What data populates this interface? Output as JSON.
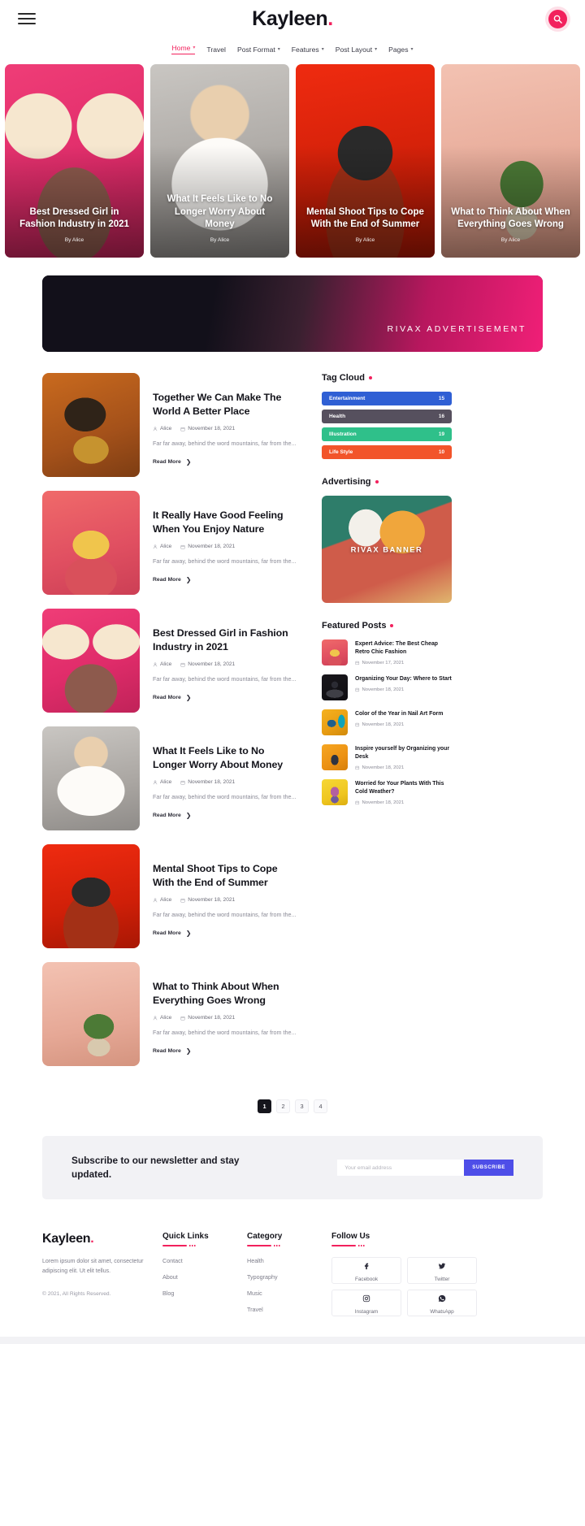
{
  "header": {
    "brand": "Kayleen",
    "brand_dot": ".",
    "menu_icon": "hamburger-icon",
    "search_icon": "search-icon",
    "accent_color": "#f2215d"
  },
  "nav": {
    "items": [
      {
        "label": "Home",
        "has_caret": true,
        "active": true
      },
      {
        "label": "Travel",
        "has_caret": false,
        "active": false
      },
      {
        "label": "Post Format",
        "has_caret": true,
        "active": false
      },
      {
        "label": "Features",
        "has_caret": true,
        "active": false
      },
      {
        "label": "Post Layout",
        "has_caret": true,
        "active": false
      },
      {
        "label": "Pages",
        "has_caret": true,
        "active": false
      }
    ]
  },
  "hero": {
    "slides": [
      {
        "title": "Best Dressed Girl in Fashion Industry in 2021",
        "by": "By Alice",
        "img": "ph1"
      },
      {
        "title": "What It Feels Like to No Longer Worry About Money",
        "by": "By Alice",
        "img": "ph2"
      },
      {
        "title": "Mental Shoot Tips to Cope With the End of Summer",
        "by": "By Alice",
        "img": "ph3"
      },
      {
        "title": "What to Think About When Everything Goes Wrong",
        "by": "By Alice",
        "img": "ph4"
      }
    ]
  },
  "ad_banner": {
    "label": "RIVAX ADVERTISEMENT"
  },
  "posts": [
    {
      "title": "Together We Can Make The World A Better Place",
      "author": "Alice",
      "date": "November 18, 2021",
      "excerpt": "Far far away, behind the word mountains, far from the...",
      "read_more": "Read More",
      "img": "ph5"
    },
    {
      "title": "It Really Have Good Feeling When You Enjoy Nature",
      "author": "Alice",
      "date": "November 18, 2021",
      "excerpt": "Far far away, behind the word mountains, far from the...",
      "read_more": "Read More",
      "img": "ph6"
    },
    {
      "title": "Best Dressed Girl in Fashion Industry in 2021",
      "author": "Alice",
      "date": "November 18, 2021",
      "excerpt": "Far far away, behind the word mountains, far from the...",
      "read_more": "Read More",
      "img": "ph1"
    },
    {
      "title": "What It Feels Like to No Longer Worry About Money",
      "author": "Alice",
      "date": "November 18, 2021",
      "excerpt": "Far far away, behind the word mountains, far from the...",
      "read_more": "Read More",
      "img": "ph2"
    },
    {
      "title": "Mental Shoot Tips to Cope With the End of Summer",
      "author": "Alice",
      "date": "November 18, 2021",
      "excerpt": "Far far away, behind the word mountains, far from the...",
      "read_more": "Read More",
      "img": "ph3"
    },
    {
      "title": "What to Think About When Everything Goes Wrong",
      "author": "Alice",
      "date": "November 18, 2021",
      "excerpt": "Far far away, behind the word mountains, far from the...",
      "read_more": "Read More",
      "img": "ph4"
    }
  ],
  "pagination": {
    "pages": [
      "1",
      "2",
      "3",
      "4"
    ],
    "current": "1"
  },
  "sidebar": {
    "tag_cloud": {
      "title": "Tag Cloud",
      "tags": [
        {
          "name": "Entertainment",
          "count": "15",
          "color": "#2f5fd4"
        },
        {
          "name": "Health",
          "count": "16",
          "color": "#56505e"
        },
        {
          "name": "Illustration",
          "count": "19",
          "color": "#2fc08a"
        },
        {
          "name": "Life Style",
          "count": "10",
          "color": "#f2542a"
        }
      ]
    },
    "advertising": {
      "title": "Advertising",
      "banner_label": "RIVAX BANNER"
    },
    "featured": {
      "title": "Featured Posts",
      "items": [
        {
          "title": "Expert Advice: The Best Cheap Retro Chic Fashion",
          "date": "November 17, 2021",
          "img": "ph6"
        },
        {
          "title": "Organizing Your Day: Where to Start",
          "date": "November 18, 2021",
          "img": "ph7"
        },
        {
          "title": "Color of the Year in Nail Art Form",
          "date": "November 18, 2021",
          "img": "ph8"
        },
        {
          "title": "Inspire yourself by Organizing your Desk",
          "date": "November 18, 2021",
          "img": "ph9"
        },
        {
          "title": "Worried for Your Plants With This Cold Weather?",
          "date": "November 18, 2021",
          "img": "ph10"
        }
      ]
    }
  },
  "newsletter": {
    "heading": "Subscribe to our newsletter and stay updated.",
    "placeholder": "Your email address",
    "value": "",
    "button": "SUBSCRIBE"
  },
  "footer": {
    "brand": "Kayleen",
    "brand_dot": ".",
    "description": "Lorem ipsum dolor sit amet, consectetur adipiscing elit. Ut elit tellus.",
    "copyright": "© 2021, All Rights Reserved.",
    "quick_links": {
      "title": "Quick Links",
      "items": [
        "Contact",
        "About",
        "Blog"
      ]
    },
    "category": {
      "title": "Category",
      "items": [
        "Health",
        "Typography",
        "Music",
        "Travel"
      ]
    },
    "follow": {
      "title": "Follow Us",
      "items": [
        {
          "label": "Facebook",
          "icon": "facebook-icon"
        },
        {
          "label": "Twitter",
          "icon": "twitter-icon"
        },
        {
          "label": "Instagram",
          "icon": "instagram-icon"
        },
        {
          "label": "WhatsApp",
          "icon": "whatsapp-icon"
        }
      ]
    }
  }
}
